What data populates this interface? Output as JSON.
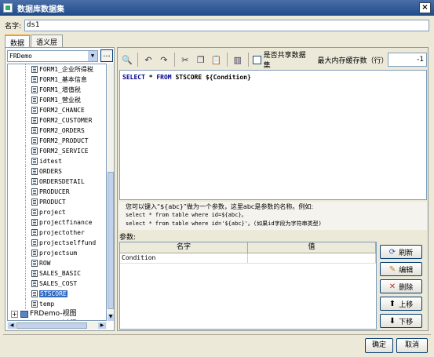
{
  "window": {
    "title": "数据库数据集",
    "close_glyph": "×"
  },
  "name_field": {
    "label": "名字:",
    "value": "ds1"
  },
  "tabs": [
    {
      "label": "数据"
    },
    {
      "label": "语义层"
    }
  ],
  "connection": {
    "selected": "FRDemo",
    "more_label": "..."
  },
  "tree": {
    "tables": [
      "FORM1_企业所得税",
      "FORM1_基本信息",
      "FORM1_增值税",
      "FORM1_营业税",
      "FORM2_CHANCE",
      "FORM2_CUSTOMER",
      "FORM2_ORDERS",
      "FORM2_PRODUCT",
      "FORM2_SERVICE",
      "idtest",
      "ORDERS",
      "ORDERSDETAIL",
      "PRODUCER",
      "PRODUCT",
      "project",
      "projectfinance",
      "projectother",
      "projectselffund",
      "projectsum",
      "ROW",
      "SALES_BASIC",
      "SALES_COST",
      "STSCORE",
      "temp"
    ],
    "selected": "STSCORE",
    "roots": [
      {
        "label": "FRDemo-视图"
      },
      {
        "label": "FRDemo-过程"
      }
    ]
  },
  "toolbar": {
    "shared_label": "是否共享数据集",
    "max_memory_label": "最大内存缓存数（行）",
    "max_memory_value": "-1"
  },
  "sql": {
    "keyword1": "SELECT",
    "star": " * ",
    "keyword2": "FROM",
    "rest": " STSCORE ${Condition}"
  },
  "hint": {
    "line1": "您可以键入“${abc}”做为一个参数，这里abc是参数的名称。例如:",
    "line2": "select * from table where id=${abc}。",
    "line3": "select * from table where id='${abc}'。(如果id字段为字符串类型)"
  },
  "params": {
    "label": "参数:",
    "columns": [
      "名字",
      "值"
    ],
    "rows": [
      {
        "name": "Condition",
        "value": ""
      }
    ]
  },
  "side_buttons": {
    "refresh": "刷新",
    "edit": "编辑",
    "delete": "删除",
    "up": "上移",
    "down": "下移"
  },
  "footer": {
    "ok": "确定",
    "cancel": "取消"
  }
}
